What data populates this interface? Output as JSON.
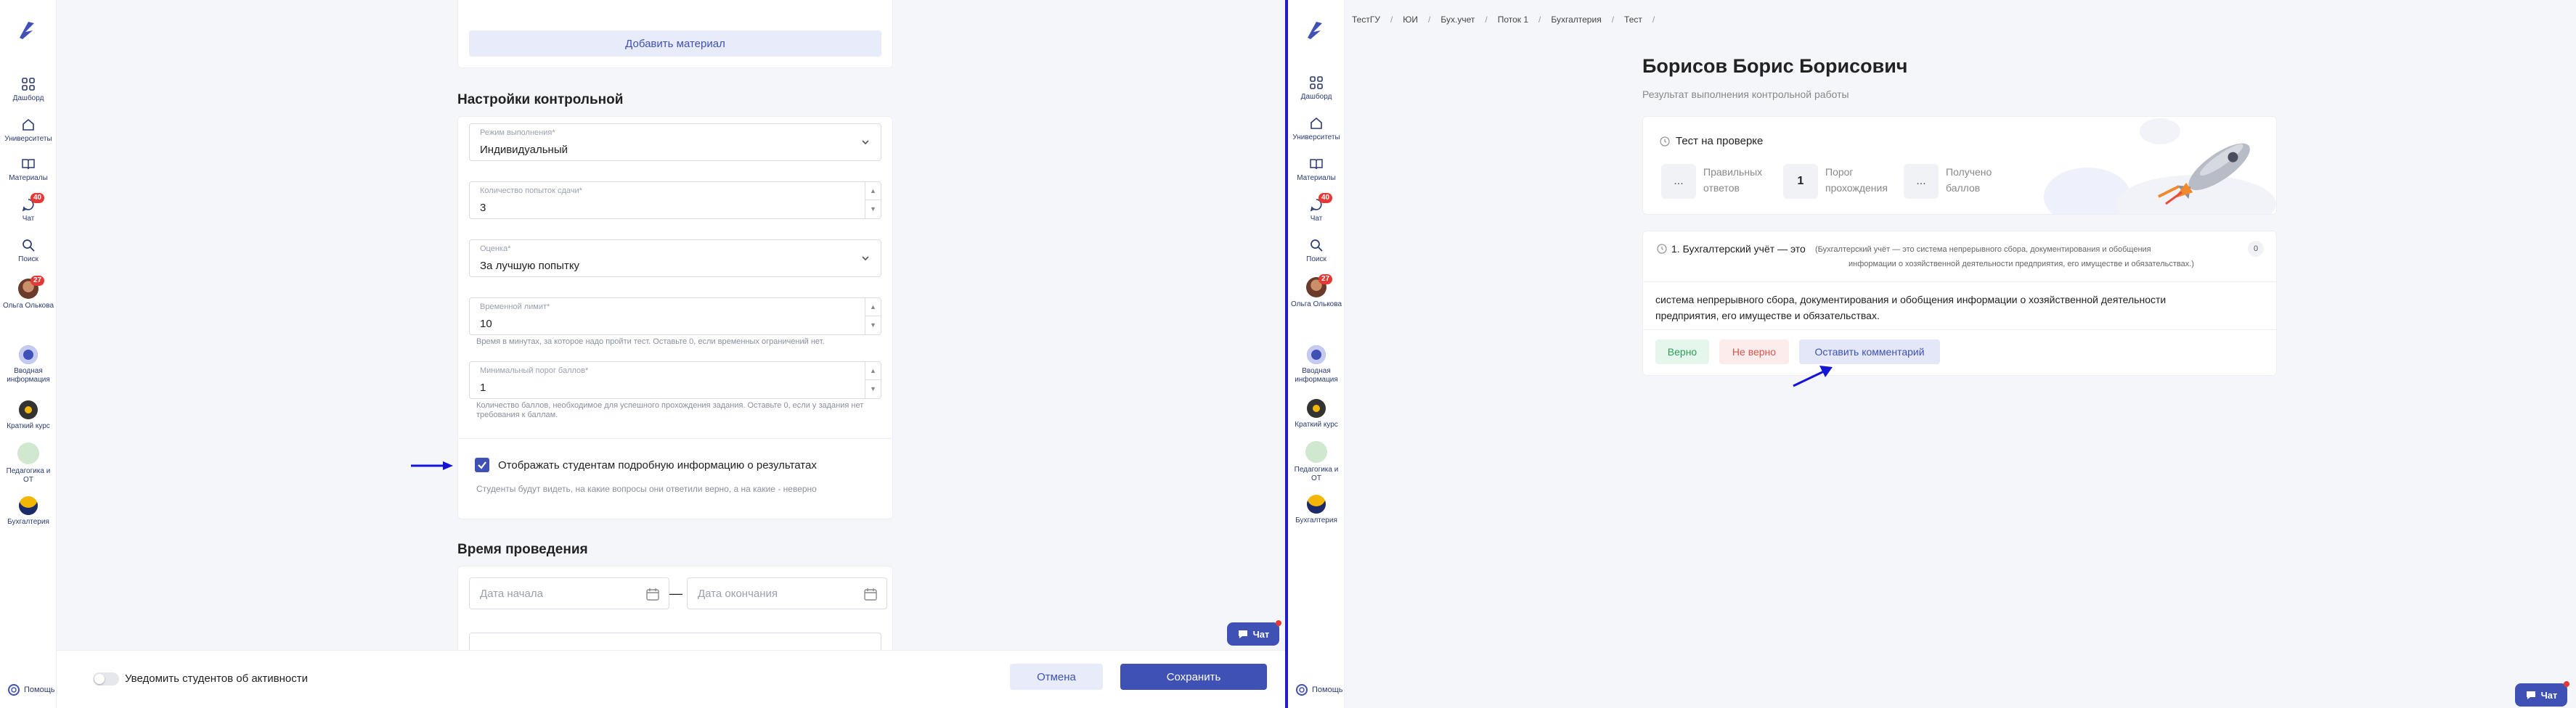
{
  "left": {
    "sidebar": [
      {
        "label": "Дашборд",
        "icon": "grid-icon"
      },
      {
        "label": "Университеты",
        "icon": "home-icon"
      },
      {
        "label": "Материалы",
        "icon": "book-icon"
      },
      {
        "label": "Чат",
        "icon": "chat-icon",
        "badge": "40"
      },
      {
        "label": "Поиск",
        "icon": "search-icon"
      },
      {
        "label": "Ольга Олькова",
        "icon": "avatar",
        "badge": "27"
      },
      {
        "label": "Вводная информация",
        "icon": "course-icon"
      },
      {
        "label": "Краткий курс",
        "icon": "course-icon"
      },
      {
        "label": "Педагогика и ОТ",
        "icon": "course-icon"
      },
      {
        "label": "Бухгалтерия",
        "icon": "course-icon"
      }
    ],
    "help": "Помощь",
    "add_material": "Добавить материал",
    "settings_title": "Настройки контрольной",
    "fields": {
      "mode": {
        "label": "Режим выполнения*",
        "value": "Индивидуальный"
      },
      "attempts": {
        "label": "Количество попыток сдачи*",
        "value": "3"
      },
      "grade": {
        "label": "Оценка*",
        "value": "За лучшую попытку"
      },
      "time_limit": {
        "label": "Временной лимит*",
        "value": "10",
        "hint": "Время в минутах, за которое надо пройти тест. Оставьте 0, если временных ограничений нет."
      },
      "threshold": {
        "label": "Минимальный порог баллов*",
        "value": "1",
        "hint": "Количество баллов, необходимое для успешного прохождения задания. Оставьте 0, если у задания нет требования к баллам."
      }
    },
    "show_results": {
      "label": "Отображать студентам подробную информацию о результатах",
      "hint": "Студенты будут видеть, на какие вопросы они ответили верно, а на какие - неверно",
      "checked": true
    },
    "time_title": "Время проведения",
    "date_start": "Дата начала",
    "date_end": "Дата окончания",
    "notify": "Уведомить студентов об активности",
    "cancel": "Отмена",
    "save": "Сохранить",
    "chat": "Чат"
  },
  "right": {
    "breadcrumbs": [
      "ТестГУ",
      "ЮИ",
      "Бух.учет",
      "Поток 1",
      "Бухгалтерия",
      "Тест"
    ],
    "title": "Борисов Борис Борисович",
    "subtitle": "Результат выполнения контрольной работы",
    "status": "Тест на проверке",
    "stats": [
      {
        "value": "...",
        "label1": "Правильных",
        "label2": "ответов"
      },
      {
        "value": "1",
        "label1": "Порог",
        "label2": "прохождения"
      },
      {
        "value": "...",
        "label1": "Получено",
        "label2": "баллов"
      }
    ],
    "question": {
      "title": "1. Бухгалтерский учёт — это",
      "detail1": "(Бухгалтерский учёт — это система непрерывного сбора, документирования и обобщения",
      "detail2": "информации о хозяйственной деятельности предприятия, его имуществе и обязательствах.)",
      "score": "0",
      "answer1": "система непрерывного сбора, документирования и обобщения информации о хозяйственной деятельности",
      "answer2": "предприятия, его имуществе и обязательствах."
    },
    "correct": "Верно",
    "incorrect": "Не верно",
    "comment": "Оставить комментарий",
    "help": "Помощь",
    "chat": "Чат"
  },
  "colors": {
    "accent": "#3f51b5",
    "divider": "#1f1fc8",
    "badge": "#e53935"
  }
}
